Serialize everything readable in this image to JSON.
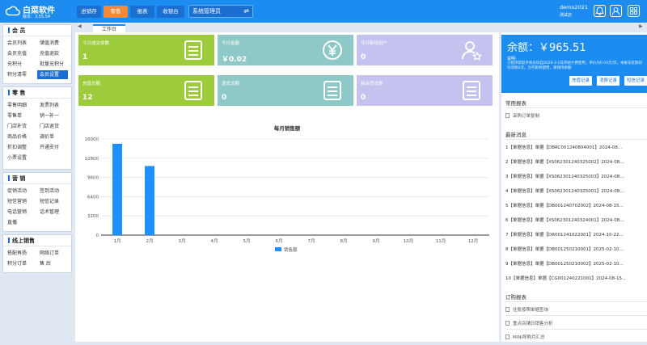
{
  "app": {
    "brand": "白菜软件",
    "version": "版本：3.55.54"
  },
  "nav": {
    "tabs": [
      "进销存",
      "零售",
      "报表",
      "收银台"
    ],
    "active_index": 1,
    "role": "系统管理员"
  },
  "user": {
    "name": "demo2021",
    "shop": "测试店"
  },
  "colors": {
    "primary": "#1c8cf0",
    "active_tab": "#f08a3c",
    "card_green": "#9ccb3b",
    "card_teal": "#8fc9c7",
    "card_lilac": "#c4c2ee",
    "bar": "#1e90ff"
  },
  "sidebar": {
    "groups": [
      {
        "title": "会 员",
        "items": [
          "会员列表",
          "储值消费",
          "会员充值",
          "充值退款",
          "充积分",
          "批量充积分",
          "积分清零",
          "会员设置"
        ],
        "active_item": "会员设置"
      },
      {
        "title": "零 售",
        "items": [
          "零售明细",
          "发票列表",
          "零售单",
          "销一补一",
          "门店补货",
          "门店退货",
          "商品价格",
          "调价单",
          "折扣调整",
          "开通支付",
          "小票设置"
        ]
      },
      {
        "title": "营 销",
        "items": [
          "促销活动",
          "签到活动",
          "短信营销",
          "短信记录",
          "电话营销",
          "话术管理",
          "直播"
        ]
      },
      {
        "title": "线上销售",
        "items": [
          "搭配再扬",
          "网络订单",
          "积分订单",
          "售 后"
        ]
      }
    ]
  },
  "workspace": {
    "tab_label": "工作台",
    "arrow_left": "◀",
    "arrow_right": "▶"
  },
  "cards": [
    {
      "title": "今日成交单数",
      "value": "1",
      "icon": "receipt-icon"
    },
    {
      "title": "今日金额",
      "value": "￥0.02",
      "icon": "yen-coin-icon"
    },
    {
      "title": "今日新增用户",
      "value": "0",
      "icon": "user-star-icon"
    },
    {
      "title": "充值总额",
      "value": "12",
      "icon": "receipt-icon"
    },
    {
      "title": "退货总额",
      "value": "0",
      "icon": "receipt-icon"
    },
    {
      "title": "新会员总数",
      "value": "0",
      "icon": "receipt-icon"
    }
  ],
  "chart_data": {
    "type": "bar",
    "title": "每月销售额",
    "categories": [
      "1月",
      "2月",
      "3月",
      "4月",
      "5月",
      "6月",
      "7月",
      "8月",
      "9月",
      "10月",
      "11月",
      "12月"
    ],
    "series": [
      {
        "name": "销售额",
        "values": [
          15200,
          11500,
          0,
          0,
          0,
          0,
          0,
          0,
          0,
          0,
          0,
          0
        ]
      }
    ],
    "y_ticks": [
      "0",
      "3200",
      "6400",
      "9600",
      "12800",
      "16000"
    ],
    "ylim": [
      0,
      16000
    ],
    "grid": true,
    "legend": "bottom"
  },
  "balance": {
    "amount": "余额：￥965.51",
    "note_label": "说明:",
    "note": "小程序获取手机号码自2024-3-1日开始计费使用，单价为0.03元/次，本账号近期日均消耗0次，为不影响使用，请保持余额",
    "buttons": [
      "充值记录",
      "消费记录",
      "短信记录"
    ]
  },
  "common_reports": {
    "title": "常用报表",
    "items": [
      "采购订单复制"
    ]
  },
  "news": {
    "title": "最新消息",
    "items": [
      "1【单据信息】单据【DBRC001240804001】2024-08...",
      "2【单据信息】单据【XS062301240325002】2024-08...",
      "3【单据信息】单据【XS062301240325003】2024-08...",
      "4【单据信息】单据【XS062301240325001】2024-08...",
      "5【单据信息】单据【DB001240702002】2024-08-15...",
      "6【单据信息】单据【XS062301240324001】2024-08...",
      "7【单据信息】单据【DR001241022001】2024-10-22...",
      "8【单据信息】单据【DB001250210001】2025-02-10...",
      "9【单据信息】单据【DB001250210002】2025-02-10...",
      "10【单据信息】单据【CG001240221001】2024-08-15..."
    ]
  },
  "order_reports": {
    "title": "订购报表",
    "items": [
      "往账按照单据查询",
      "重点店铺日销售分析",
      "MINI导购月汇总"
    ]
  }
}
